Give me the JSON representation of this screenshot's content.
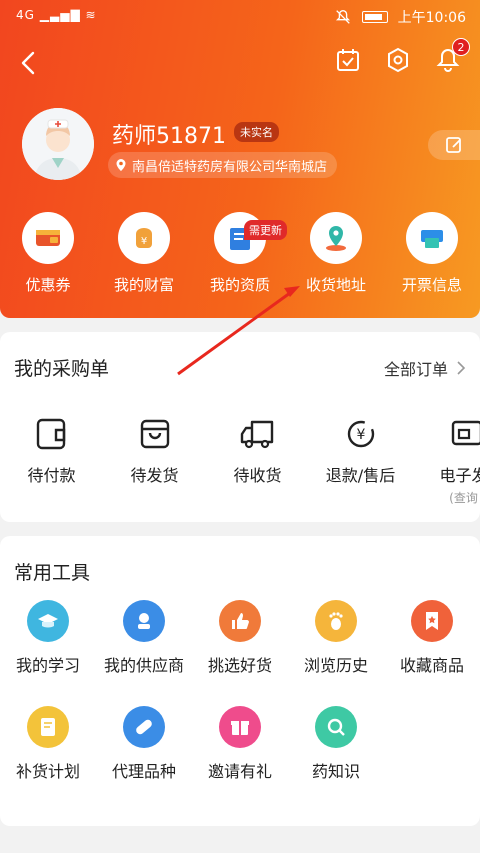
{
  "status": {
    "network": "4G",
    "time": "上午10:06"
  },
  "header": {
    "notification_count": "2"
  },
  "profile": {
    "name": "药师51871",
    "verify_badge": "未实名",
    "shop": "南昌倍适特药房有限公司华南城店"
  },
  "quick_actions": [
    {
      "label": "优惠券",
      "icon": "coupon-icon",
      "color": "#e8542a"
    },
    {
      "label": "我的财富",
      "icon": "wallet-icon",
      "color": "#f1a13a"
    },
    {
      "label": "我的资质",
      "icon": "certificate-icon",
      "color": "#2f7fe0",
      "badge": "需更新"
    },
    {
      "label": "收货地址",
      "icon": "location-icon",
      "color": "#30b7a8"
    },
    {
      "label": "开票信息",
      "icon": "invoice-icon",
      "color": "#2c8ee8"
    }
  ],
  "orders": {
    "title": "我的采购单",
    "all_label": "全部订单",
    "items": [
      {
        "label": "待付款",
        "icon": "wallet-outline-icon"
      },
      {
        "label": "待发货",
        "icon": "package-icon"
      },
      {
        "label": "待收货",
        "icon": "truck-icon"
      },
      {
        "label": "退款/售后",
        "icon": "refund-icon"
      },
      {
        "label": "电子发",
        "sub": "(查询",
        "icon": "e-invoice-icon"
      }
    ]
  },
  "tools": {
    "title": "常用工具",
    "row1": [
      {
        "label": "我的学习",
        "icon": "graduation-icon",
        "color": "#3fb6e0"
      },
      {
        "label": "我的供应商",
        "icon": "supplier-icon",
        "color": "#3b8de6"
      },
      {
        "label": "挑选好货",
        "icon": "thumbs-up-icon",
        "color": "#f07a3a"
      },
      {
        "label": "浏览历史",
        "icon": "footprint-icon",
        "color": "#f5b53b"
      },
      {
        "label": "收藏商品",
        "icon": "bookmark-icon",
        "color": "#f0623a"
      }
    ],
    "row2": [
      {
        "label": "补货计划",
        "icon": "plan-icon",
        "color": "#f3c33a"
      },
      {
        "label": "代理品种",
        "icon": "pill-icon",
        "color": "#3b8de6"
      },
      {
        "label": "邀请有礼",
        "icon": "gift-icon",
        "color": "#ef4c8c"
      },
      {
        "label": "药知识",
        "icon": "search-knowledge-icon",
        "color": "#3ec9a4"
      }
    ]
  }
}
